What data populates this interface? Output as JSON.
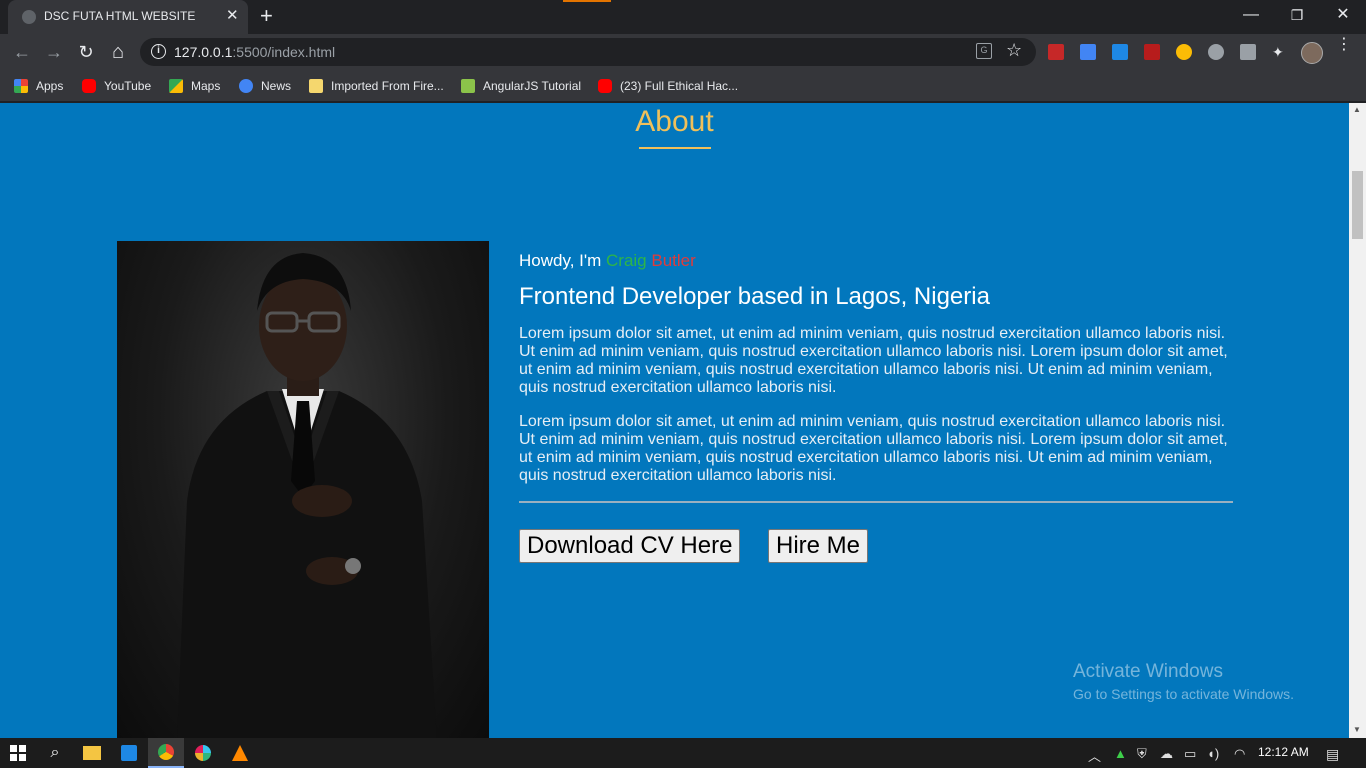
{
  "browser": {
    "tab_title": "DSC FUTA HTML WEBSITE",
    "tab_close": "✕",
    "new_tab": "+",
    "url_host": "127.0.0.1",
    "url_rest": ":5500/index.html",
    "window_controls": {
      "minimize": "—",
      "restore": "❐",
      "close": "✕"
    },
    "nav": {
      "back": "←",
      "forward": "→",
      "reload": "↻",
      "home": "⌂"
    }
  },
  "bookmarks": [
    {
      "label": "Apps",
      "icon": "apps-grid-icon",
      "color": "#ea4335"
    },
    {
      "label": "YouTube",
      "icon": "youtube-icon",
      "color": "#ff0000"
    },
    {
      "label": "Maps",
      "icon": "maps-icon",
      "color": "#34a853"
    },
    {
      "label": "News",
      "icon": "news-icon",
      "color": "#4285f4"
    },
    {
      "label": "Imported From Fire...",
      "icon": "folder-icon",
      "color": "#f5d76e"
    },
    {
      "label": "AngularJS Tutorial",
      "icon": "angular-tutorial-icon",
      "color": "#8bc34a"
    },
    {
      "label": "(23) Full Ethical Hac...",
      "icon": "youtube-icon",
      "color": "#ff0000"
    }
  ],
  "page": {
    "section_title": "About",
    "greeting_prefix": "Howdy, I'm",
    "first_name": "Craig",
    "last_name": "Butler",
    "role": "Frontend Developer based in Lagos, Nigeria",
    "paragraph1": "Lorem ipsum dolor sit amet, ut enim ad minim veniam, quis nostrud exercitation ullamco laboris nisi. Ut enim ad minim veniam, quis nostrud exercitation ullamco laboris nisi. Lorem ipsum dolor sit amet, ut enim ad minim veniam, quis nostrud exercitation ullamco laboris nisi. Ut enim ad minim veniam, quis nostrud exercitation ullamco laboris nisi.",
    "paragraph2": "Lorem ipsum dolor sit amet, ut enim ad minim veniam, quis nostrud exercitation ullamco laboris nisi. Ut enim ad minim veniam, quis nostrud exercitation ullamco laboris nisi. Lorem ipsum dolor sit amet, ut enim ad minim veniam, quis nostrud exercitation ullamco laboris nisi. Ut enim ad minim veniam, quis nostrud exercitation ullamco laboris nisi.",
    "download_button": "Download CV Here",
    "hire_button": "Hire Me",
    "colors": {
      "background": "#0277bd",
      "accent": "#f0c05a",
      "first_name": "#2db548",
      "last_name": "#e03b3b"
    }
  },
  "watermark": {
    "line1": "Activate Windows",
    "line2": "Go to Settings to activate Windows."
  },
  "taskbar": {
    "time": "12:12 AM"
  }
}
